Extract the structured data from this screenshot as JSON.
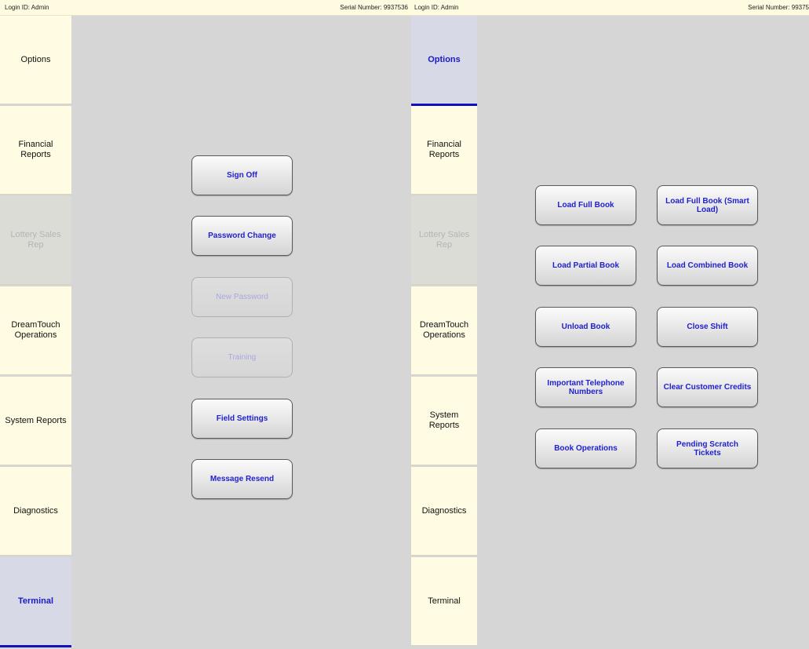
{
  "left_screen": {
    "login_id": "Login ID: Admin",
    "serial_number": "Serial Number: 9937536",
    "nav": [
      {
        "label": "Options",
        "state": "normal"
      },
      {
        "label": "Financial Reports",
        "state": "normal"
      },
      {
        "label": "Lottery Sales Rep",
        "state": "disabled"
      },
      {
        "label": "DreamTouch Operations",
        "state": "normal"
      },
      {
        "label": "System Reports",
        "state": "normal"
      },
      {
        "label": "Diagnostics",
        "state": "normal"
      },
      {
        "label": "Terminal",
        "state": "active"
      }
    ],
    "buttons": [
      {
        "label": "Sign Off",
        "enabled": true
      },
      {
        "label": "Password Change",
        "enabled": true
      },
      {
        "label": "New Password",
        "enabled": false
      },
      {
        "label": "Training",
        "enabled": false
      },
      {
        "label": "Field Settings",
        "enabled": true
      },
      {
        "label": "Message Resend",
        "enabled": true
      }
    ]
  },
  "right_screen": {
    "login_id": "Login ID: Admin",
    "serial_number": "Serial Number: 99375",
    "nav": [
      {
        "label": "Options",
        "state": "active"
      },
      {
        "label": "Financial Reports",
        "state": "normal"
      },
      {
        "label": "Lottery Sales Rep",
        "state": "disabled"
      },
      {
        "label": "DreamTouch Operations",
        "state": "normal"
      },
      {
        "label": "System Reports",
        "state": "normal"
      },
      {
        "label": "Diagnostics",
        "state": "normal"
      },
      {
        "label": "Terminal",
        "state": "normal"
      }
    ],
    "buttons": [
      {
        "label": "Load Full Book"
      },
      {
        "label": "Load Full Book (Smart Load)"
      },
      {
        "label": "Load Partial Book"
      },
      {
        "label": "Load Combined Book"
      },
      {
        "label": "Unload Book"
      },
      {
        "label": "Close Shift"
      },
      {
        "label": "Important Telephone Numbers"
      },
      {
        "label": "Clear Customer Credits"
      },
      {
        "label": "Book Operations"
      },
      {
        "label": "Pending Scratch Tickets"
      }
    ]
  },
  "colors": {
    "content_bg": "#d6d6d6",
    "sidebar_bg": "#fffce3",
    "active_nav_bg": "#d7d9e6",
    "accent_blue": "#1111c0",
    "button_text": "#1f1fcf"
  }
}
